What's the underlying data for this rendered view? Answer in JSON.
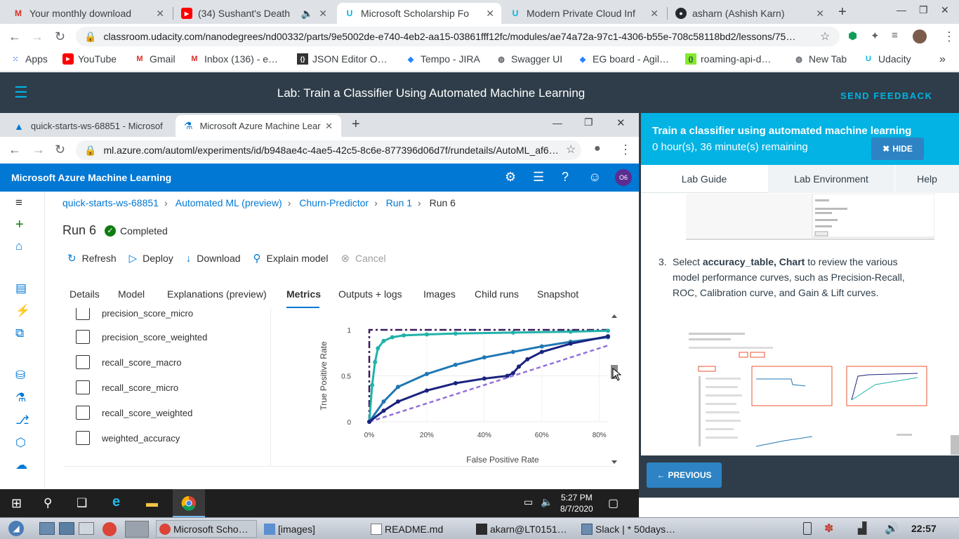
{
  "outer_browser": {
    "tabs": [
      {
        "title": "Your monthly download",
        "icon": "gmail-icon"
      },
      {
        "title": "(34) Sushant's Death",
        "icon": "youtube-icon"
      },
      {
        "title": "Microsoft Scholarship Fo",
        "icon": "udacity-icon"
      },
      {
        "title": "Modern Private Cloud Inf",
        "icon": "udacity-icon"
      },
      {
        "title": "asharn (Ashish Karn)",
        "icon": "github-icon"
      }
    ],
    "new_tab": "+",
    "url": "classroom.udacity.com/nanodegrees/nd00332/parts/9e5002de-e740-4eb2-aa15-03861fff12fc/modules/ae74a72a-97c1-4306-b55e-708c58118bd2/lessons/75…",
    "bookmarks": [
      {
        "label": "Apps",
        "icon": "apps-grid-icon"
      },
      {
        "label": "YouTube",
        "icon": "youtube-icon"
      },
      {
        "label": "Gmail",
        "icon": "gmail-icon"
      },
      {
        "label": "Inbox (136) - e…",
        "icon": "gmail-icon"
      },
      {
        "label": "JSON Editor O…",
        "icon": "json-icon"
      },
      {
        "label": "Tempo - JIRA",
        "icon": "jira-icon"
      },
      {
        "label": "Swagger UI",
        "icon": "globe-icon"
      },
      {
        "label": "EG board - Agil…",
        "icon": "jira-icon"
      },
      {
        "label": "roaming-api-d…",
        "icon": "swagger-icon"
      },
      {
        "label": "New Tab",
        "icon": "globe-icon"
      },
      {
        "label": "Udacity",
        "icon": "udacity-icon"
      }
    ],
    "more": "»"
  },
  "udacity": {
    "header_title": "Lab: Train a Classifier Using Automated Machine Learning",
    "send_feedback": "SEND FEEDBACK",
    "panel_title": "Train a classifier using automated machine learning",
    "time_remaining": "0 hour(s), 36 minute(s) remaining",
    "hide_label": "HIDE",
    "tabs": [
      "Lab Guide",
      "Lab Environment",
      "Help"
    ],
    "step_number": "3.",
    "step_pre": "Select ",
    "step_bold": "accuracy_table, Chart",
    "step_post": " to review the various model performance curves, such as Precision-Recall, ROC, Calibration curve, and Gain & Lift curves.",
    "previous_label": "PREVIOUS"
  },
  "inner_browser": {
    "tabs": [
      {
        "title": "quick-starts-ws-68851 - Microsof"
      },
      {
        "title": "Microsoft Azure Machine Learnin"
      }
    ],
    "url": "ml.azure.com/automl/experiments/id/b948ae4c-4ae5-42c5-8c6e-877396d06d7f/rundetails/AutoML_af6…"
  },
  "azure": {
    "brand": "Microsoft Azure Machine Learning",
    "avatar": "O6",
    "breadcrumb": [
      "quick-starts-ws-68851",
      "Automated ML (preview)",
      "Churn-Predictor",
      "Run 1",
      "Run 6"
    ],
    "run_title": "Run 6",
    "status": "Completed",
    "commands": [
      "Refresh",
      "Deploy",
      "Download",
      "Explain model",
      "Cancel"
    ],
    "tabs": [
      "Details",
      "Model",
      "Explanations (preview)",
      "Metrics",
      "Outputs + logs",
      "Images",
      "Child runs",
      "Snapshot"
    ],
    "selected_tab": "Metrics",
    "metrics": [
      {
        "label": "precision_score_micro",
        "checked": false
      },
      {
        "label": "precision_score_weighted",
        "checked": false
      },
      {
        "label": "recall_score_macro",
        "checked": false
      },
      {
        "label": "recall_score_micro",
        "checked": false
      },
      {
        "label": "recall_score_weighted",
        "checked": false
      },
      {
        "label": "weighted_accuracy",
        "checked": false
      }
    ]
  },
  "chart_data": {
    "type": "line",
    "xlabel": "False Positive Rate",
    "ylabel": "True Positive Rate",
    "xlim": [
      0,
      0.83
    ],
    "ylim": [
      0,
      1
    ],
    "x_ticks": [
      "0%",
      "20%",
      "40%",
      "60%",
      "80%"
    ],
    "y_ticks": [
      "0",
      "0.5",
      "1"
    ],
    "series": [
      {
        "color": "#3a1a5c",
        "style": "dashdot",
        "x": [
          0,
          0,
          0.83
        ],
        "y": [
          0,
          1,
          1
        ]
      },
      {
        "color": "#9370db",
        "style": "dash",
        "x": [
          0,
          0.83
        ],
        "y": [
          0,
          0.83
        ]
      },
      {
        "color": "#20b2aa",
        "style": "solid",
        "x": [
          0,
          0.01,
          0.02,
          0.03,
          0.05,
          0.08,
          0.12,
          0.2,
          0.3,
          0.5,
          0.7,
          0.83
        ],
        "y": [
          0,
          0.4,
          0.65,
          0.8,
          0.88,
          0.92,
          0.94,
          0.95,
          0.96,
          0.97,
          0.98,
          0.99
        ]
      },
      {
        "color": "#1f77b4",
        "style": "solid",
        "x": [
          0,
          0.05,
          0.1,
          0.2,
          0.3,
          0.4,
          0.5,
          0.6,
          0.7,
          0.83
        ],
        "y": [
          0,
          0.22,
          0.38,
          0.52,
          0.62,
          0.7,
          0.76,
          0.82,
          0.87,
          0.92
        ]
      },
      {
        "color": "#1a237e",
        "style": "solid",
        "x": [
          0,
          0.05,
          0.1,
          0.2,
          0.3,
          0.4,
          0.48,
          0.5,
          0.52,
          0.55,
          0.6,
          0.7,
          0.83
        ],
        "y": [
          0,
          0.12,
          0.22,
          0.34,
          0.42,
          0.47,
          0.5,
          0.53,
          0.6,
          0.68,
          0.76,
          0.85,
          0.93
        ]
      }
    ]
  },
  "windows_taskbar": {
    "time": "5:27 PM",
    "date": "8/7/2020"
  },
  "linux_panel": {
    "items": [
      {
        "label": "Microsoft Scho…"
      },
      {
        "label": "[images]"
      },
      {
        "label": "README.md"
      },
      {
        "label": "akarn@LT0151…"
      },
      {
        "label": "Slack | * 50days…"
      }
    ],
    "clock": "22:57"
  }
}
